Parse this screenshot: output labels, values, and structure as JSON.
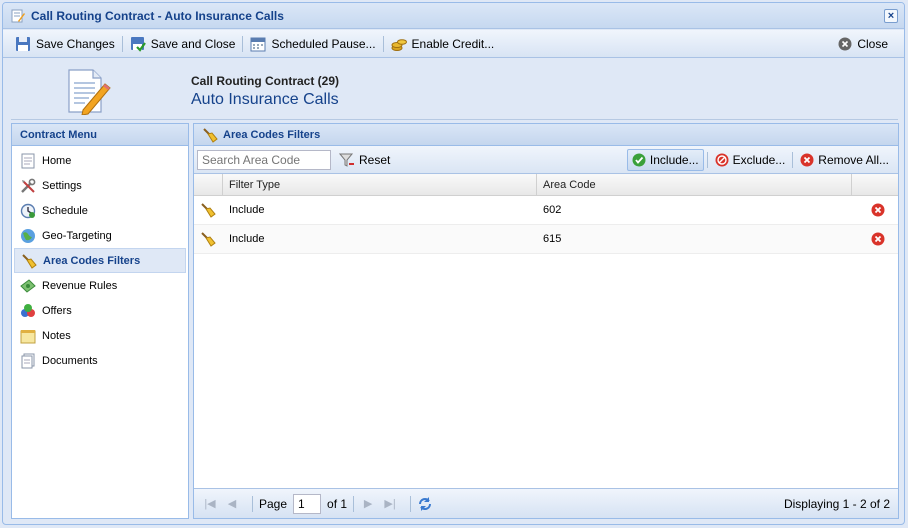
{
  "window": {
    "title": "Call Routing Contract - Auto Insurance Calls",
    "close_symbol": "×"
  },
  "toolbar": {
    "save_changes": "Save Changes",
    "save_and_close": "Save and Close",
    "scheduled_pause": "Scheduled Pause...",
    "enable_credit": "Enable Credit...",
    "close": "Close"
  },
  "header": {
    "subtitle": "Call Routing Contract (29)",
    "title": "Auto Insurance Calls"
  },
  "sidebar": {
    "heading": "Contract Menu",
    "items": [
      {
        "label": "Home",
        "icon": "home-page-icon"
      },
      {
        "label": "Settings",
        "icon": "tools-icon"
      },
      {
        "label": "Schedule",
        "icon": "clock-icon"
      },
      {
        "label": "Geo-Targeting",
        "icon": "globe-icon"
      },
      {
        "label": "Area Codes Filters",
        "icon": "broom-icon",
        "active": true
      },
      {
        "label": "Revenue Rules",
        "icon": "money-icon"
      },
      {
        "label": "Offers",
        "icon": "shapes-icon"
      },
      {
        "label": "Notes",
        "icon": "note-icon"
      },
      {
        "label": "Documents",
        "icon": "documents-icon"
      }
    ]
  },
  "panel": {
    "heading": "Area Codes Filters",
    "search_placeholder": "Search Area Code",
    "reset": "Reset",
    "include": "Include...",
    "exclude": "Exclude...",
    "remove_all": "Remove All..."
  },
  "grid": {
    "columns": [
      "Filter Type",
      "Area Code"
    ],
    "rows": [
      {
        "filter_type": "Include",
        "area_code": "602"
      },
      {
        "filter_type": "Include",
        "area_code": "615"
      }
    ]
  },
  "pager": {
    "page_label": "Page",
    "page_value": "1",
    "of_label": "of 1",
    "display": "Displaying 1 - 2 of 2"
  },
  "colors": {
    "accent": "#15428b",
    "border": "#99bbe8",
    "panel_bg": "#dfe8f6",
    "delete_red": "#d9332a"
  }
}
